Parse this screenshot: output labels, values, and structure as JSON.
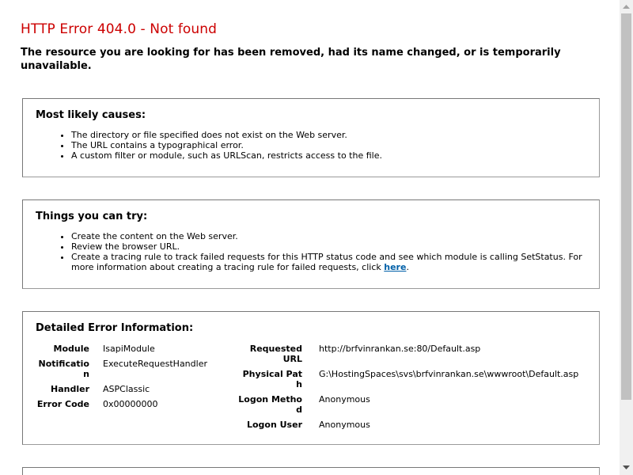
{
  "error": {
    "title": "HTTP Error 404.0 - Not found",
    "summary": "The resource you are looking for has been removed, had its name changed, or is temporarily unavailable."
  },
  "causes": {
    "heading": "Most likely causes:",
    "items": [
      "The directory or file specified does not exist on the Web server.",
      "The URL contains a typographical error.",
      "A custom filter or module, such as URLScan, restricts access to the file."
    ]
  },
  "try": {
    "heading": "Things you can try:",
    "items": [
      "Create the content on the Web server.",
      "Review the browser URL.",
      "Create a tracing rule to track failed requests for this HTTP status code and see which module is calling SetStatus. For more information about creating a tracing rule for failed requests, click"
    ],
    "link_text": "here",
    "link_suffix": "."
  },
  "detail": {
    "heading": "Detailed Error Information:",
    "left": {
      "module_label": "Module",
      "module_value": "IsapiModule",
      "notification_label": "Notification",
      "notification_value": "ExecuteRequestHandler",
      "handler_label": "Handler",
      "handler_value": "ASPClassic",
      "error_code_label": "Error Code",
      "error_code_value": "0x00000000"
    },
    "right": {
      "requested_url_label": "Requested URL",
      "requested_url_value": "http://brfvinrankan.se:80/Default.asp",
      "physical_path_label": "Physical Path",
      "physical_path_value": "G:\\HostingSpaces\\svs\\brfvinrankan.se\\wwwroot\\Default.asp",
      "logon_method_label": "Logon Method",
      "logon_method_value": "Anonymous",
      "logon_user_label": "Logon User",
      "logon_user_value": "Anonymous"
    }
  },
  "colors": {
    "title_red": "#cc0000",
    "link_blue": "#0060a8",
    "border": "#777777"
  }
}
